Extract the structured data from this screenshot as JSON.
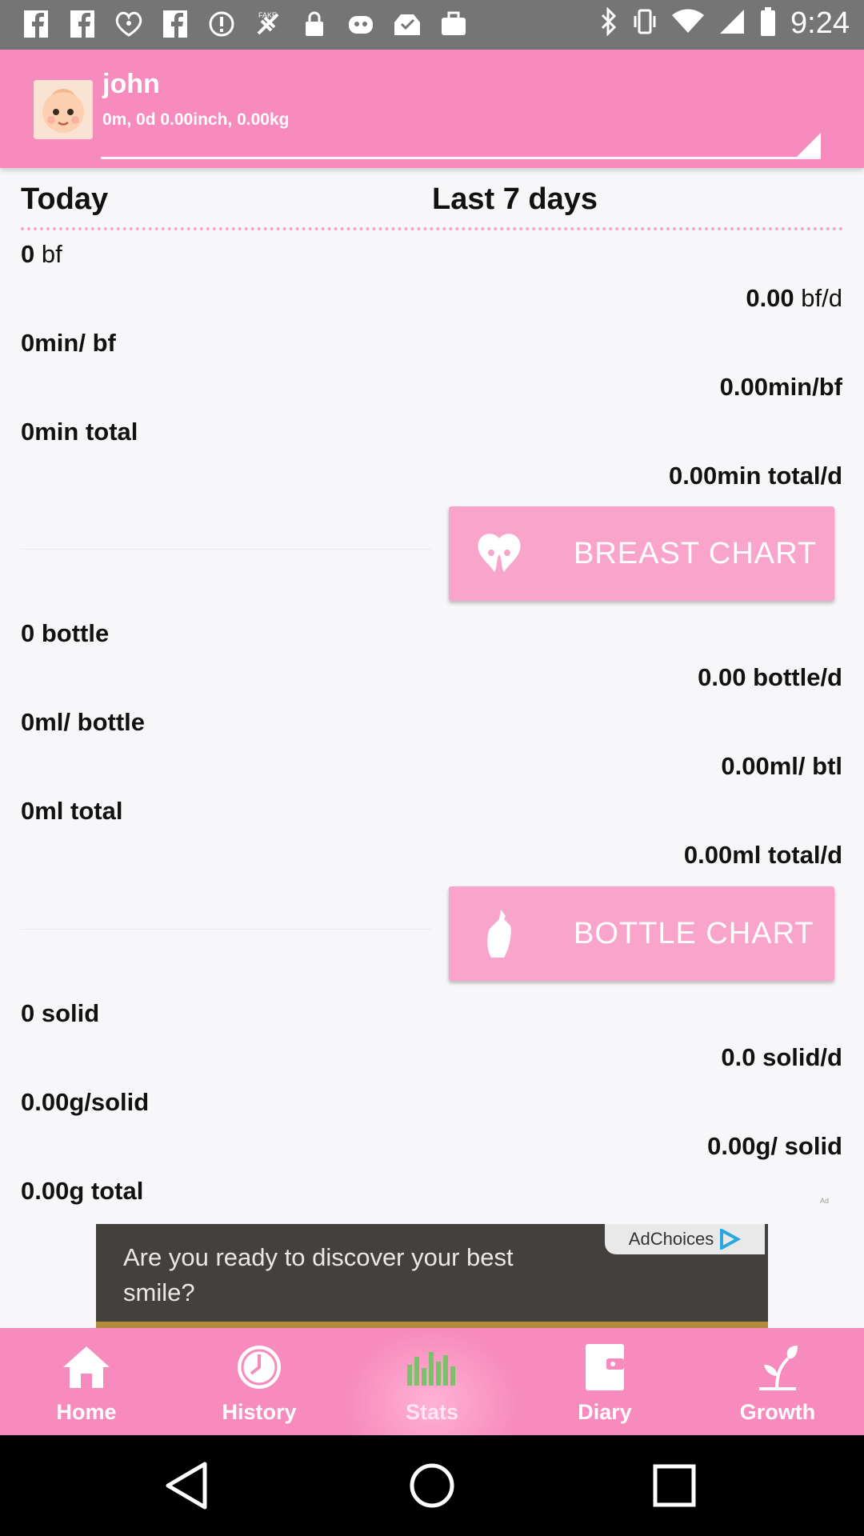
{
  "status_bar": {
    "time": "9:24",
    "left_icons": [
      "facebook-icon",
      "facebook-icon",
      "iheartradio-icon",
      "facebook-icon",
      "info-icon",
      "fake-gps-icon",
      "lock-icon",
      "app-icon",
      "inbox-icon",
      "bag-icon"
    ],
    "right_icons": [
      "bluetooth-icon",
      "vibrate-icon",
      "wifi-icon",
      "signal-icon",
      "battery-icon"
    ]
  },
  "profile": {
    "name": "john",
    "details": "0m, 0d 0.00inch, 0.00kg"
  },
  "columns": {
    "today": "Today",
    "last7": "Last 7 days"
  },
  "breast": {
    "today_count_num": "0",
    "today_count_unit": " bf",
    "avg_count_num": "0.00",
    "avg_count_unit": " bf/d",
    "today_per": "0min/ bf",
    "avg_per": "0.00min/bf",
    "today_total": "0min total",
    "avg_total": "0.00min total/d",
    "chart_label": "BREAST CHART"
  },
  "bottle": {
    "today_count": "0 bottle",
    "avg_count": "0.00 bottle/d",
    "today_per": "0ml/ bottle",
    "avg_per": "0.00ml/ btl",
    "today_total": "0ml total",
    "avg_total": "0.00ml total/d",
    "chart_label": "BOTTLE CHART"
  },
  "solid": {
    "today_count": "0 solid",
    "avg_count": "0.0 solid/d",
    "today_per": "0.00g/solid",
    "avg_per": "0.00g/ solid",
    "today_total": "0.00g total",
    "ad_mark": "Ad"
  },
  "ad": {
    "text": "Are you ready to discover your best smile?",
    "choices": "AdChoices"
  },
  "nav": {
    "items": [
      {
        "label": "Home",
        "icon": "home-icon"
      },
      {
        "label": "History",
        "icon": "clock-icon"
      },
      {
        "label": "Stats",
        "icon": "bar-chart-icon"
      },
      {
        "label": "Diary",
        "icon": "diary-icon"
      },
      {
        "label": "Growth",
        "icon": "sprout-icon"
      }
    ],
    "active": "Stats"
  },
  "colors": {
    "header": "#f78bbd",
    "button": "#f9a4cb",
    "dots": "#f6a8c9"
  }
}
